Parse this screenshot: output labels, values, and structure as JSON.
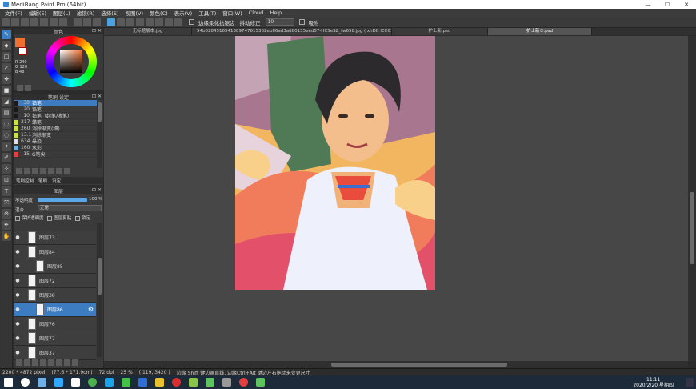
{
  "window": {
    "title": "MediBang Paint Pro (64bit)",
    "minimize": "—",
    "maximize": "☐",
    "close": "✕"
  },
  "menu": [
    "文件(F)",
    "编辑(E)",
    "图层(L)",
    "滤镜(R)",
    "选择(S)",
    "视图(V)",
    "颜色(C)",
    "表示(V)",
    "工具(T)",
    "窗口(W)",
    "Cloud",
    "Help"
  ],
  "toolbar": {
    "antialias_label": "边缘柔化抗锯齿",
    "correction_label": "抖动修正",
    "correction_value": "10",
    "snap_label": "吸附"
  },
  "tabs": [
    {
      "label": "无标题版本.jpg",
      "active": false
    },
    {
      "label": "54b0284516541389747615362eb86ad3ad80135eed57-HCSeSZ_fw658.jpg ( xhDB IEC61966-2.1 )",
      "active": false
    },
    {
      "label": "护士新.psd",
      "active": false
    },
    {
      "label": "护士新①.psd",
      "active": true
    }
  ],
  "color_panel": {
    "title": "颜色",
    "readout": "R 240\nG 120\nB 48",
    "main_color": "#f07030"
  },
  "brush_panel": {
    "title": "笔刷  设定",
    "items": [
      {
        "num": "30",
        "name": "铅笔",
        "color": "#1a1a1a",
        "selected": true
      },
      {
        "num": "20",
        "name": "铅笔",
        "color": "#1a1a1a",
        "selected": false
      },
      {
        "num": "10",
        "name": "铅笔（起笔/收笔）",
        "color": "#1a1a1a",
        "selected": false
      },
      {
        "num": "217",
        "name": "蜡笔",
        "color": "#c8e04a",
        "selected": false
      },
      {
        "num": "260",
        "name": "消除渐变(细)",
        "color": "#c8e04a",
        "selected": false
      },
      {
        "num": "13.1",
        "name": "消除渐变",
        "color": "#c8e04a",
        "selected": false
      },
      {
        "num": "634",
        "name": "晕染",
        "color": "#e0e0e0",
        "selected": false
      },
      {
        "num": "160",
        "name": "水彩",
        "color": "#6bb0e0",
        "selected": false
      },
      {
        "num": "15",
        "name": "G笔尖",
        "color": "#e04040",
        "selected": false
      }
    ],
    "subtabs": [
      "笔刷控制",
      "笔刷",
      "设定"
    ]
  },
  "layer_panel": {
    "title": "图层",
    "opacity_label": "不透明度",
    "opacity_value": "100 %",
    "opacity_fraction": 1.0,
    "blend_label": "混合",
    "blend_value": "正常",
    "protect_label": "保护透明度",
    "clip_label": "图层剪贴",
    "lock_label": "锁定",
    "layers": [
      {
        "name": "图层73",
        "selected": false,
        "indent": false
      },
      {
        "name": "图层84",
        "selected": false,
        "indent": false
      },
      {
        "name": "图层85",
        "selected": false,
        "indent": true
      },
      {
        "name": "图层72",
        "selected": false,
        "indent": false
      },
      {
        "name": "图层38",
        "selected": false,
        "indent": false
      },
      {
        "name": "图层86",
        "selected": true,
        "indent": true
      },
      {
        "name": "图层76",
        "selected": false,
        "indent": false
      },
      {
        "name": "图层77",
        "selected": false,
        "indent": false
      },
      {
        "name": "图层37",
        "selected": false,
        "indent": false
      }
    ]
  },
  "status": {
    "size": "2200 * 4872 pixel",
    "dimensions": "(77.6 * 171.9cm)",
    "dpi": "72 dpi",
    "zoom": "25 %",
    "coords": "( 119, 3420 )",
    "hint": "边缘 Shift 键边画直线,  边缘Ctrl+Alt 键边左右拖动来变更尺寸"
  },
  "taskbar": {
    "time": "11:11",
    "date": "2020/2/20 星期四"
  }
}
